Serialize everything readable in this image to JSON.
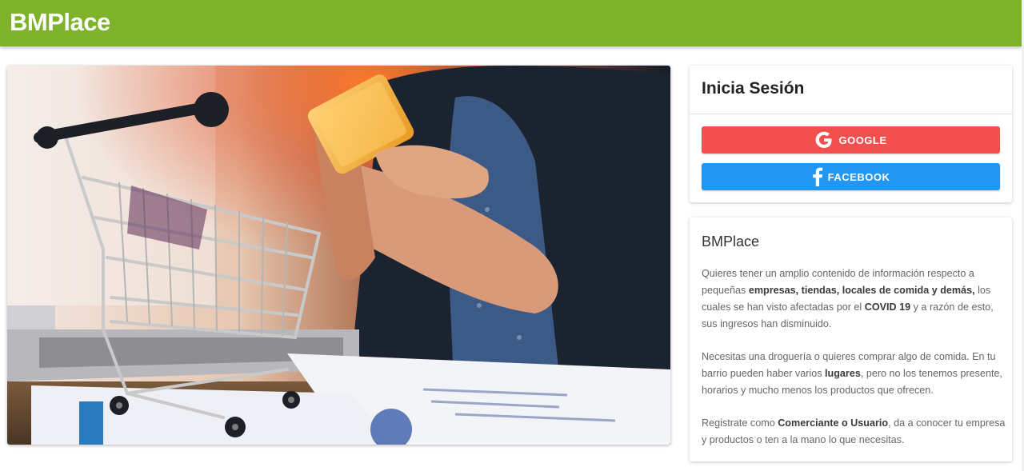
{
  "app": {
    "brand": "BMPlace"
  },
  "hero": {
    "image_name": "shopping-cart-phone-photo"
  },
  "login": {
    "title": "Inicia Sesión",
    "google_label": "GOOGLE",
    "facebook_label": "FACEBOOK",
    "google_color": "#f44f4f",
    "facebook_color": "#2196f3"
  },
  "info": {
    "title": "BMPlace",
    "p1": {
      "a": "Quieres tener un amplio contenido de información respecto a pequeñas ",
      "b": "empresas, tiendas, locales de comida y demás,",
      "c": " los cuales se han visto afectadas por el ",
      "d": "COVID 19",
      "e": " y a razón de esto, sus ingresos han disminuido."
    },
    "p2": {
      "a": "Necesitas una droguería o quieres comprar algo de comida. En tu barrio pueden haber varios ",
      "b": "lugares",
      "c": ", pero no los tenemos presente, horarios y mucho menos los productos que ofrecen."
    },
    "p3": {
      "a": "Registrate como ",
      "b": "Comerciante o Usuario",
      "c": ", da a conocer tu empresa y productos o ten a la mano lo que necesitas."
    }
  },
  "colors": {
    "header": "#7db22a"
  }
}
